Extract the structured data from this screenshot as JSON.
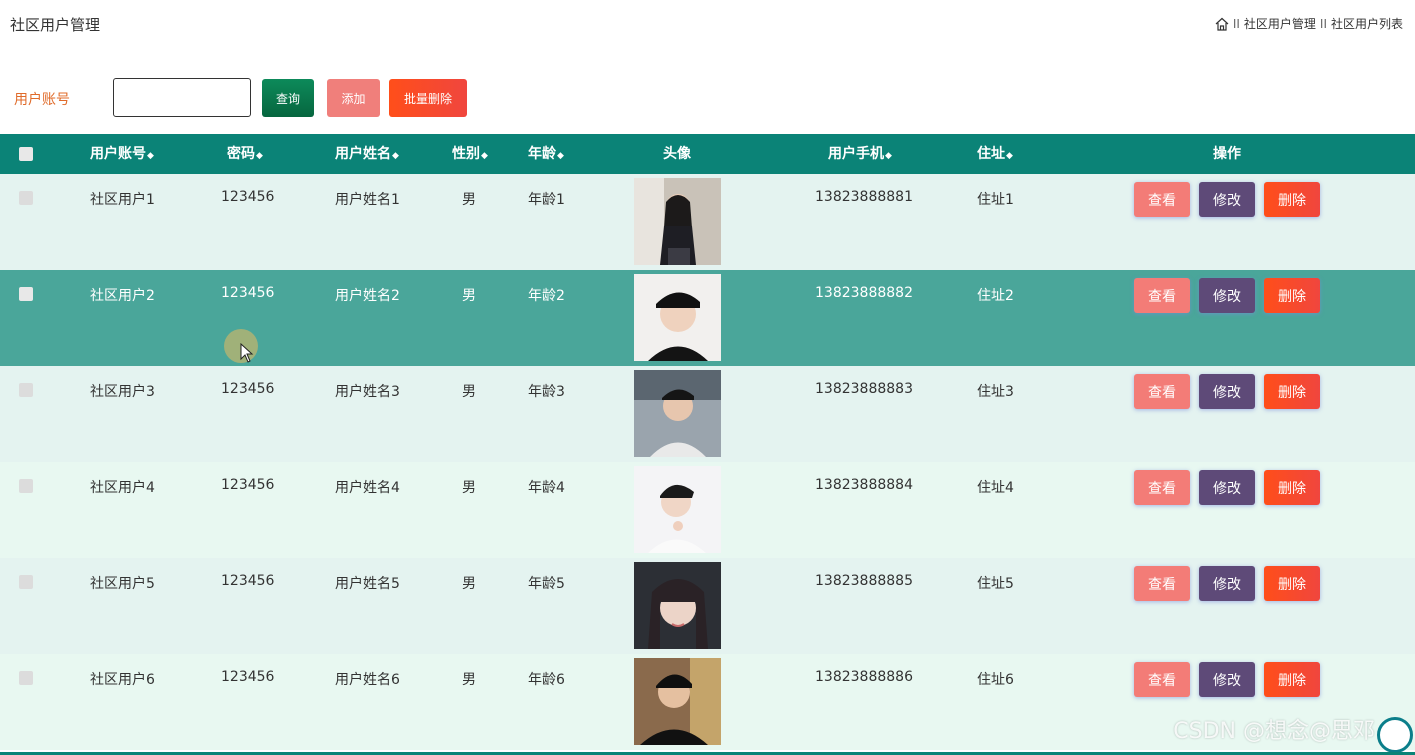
{
  "header": {
    "title": "社区用户管理",
    "breadcrumb": [
      "社区用户管理",
      "社区用户列表"
    ],
    "breadcrumb_sep": "II"
  },
  "search": {
    "label": "用户账号",
    "value": "",
    "query_label": "查询",
    "add_label": "添加",
    "batch_delete_label": "批量删除"
  },
  "table": {
    "columns": [
      "用户账号",
      "密码",
      "用户姓名",
      "性别",
      "年龄",
      "头像",
      "用户手机",
      "住址",
      "操作"
    ],
    "sort_glyph": "◆",
    "rows": [
      {
        "account": "社区用户1",
        "password": "123456",
        "name": "用户姓名1",
        "gender": "男",
        "age": "年龄1",
        "phone": "13823888881",
        "address": "住址1"
      },
      {
        "account": "社区用户2",
        "password": "123456",
        "name": "用户姓名2",
        "gender": "男",
        "age": "年龄2",
        "phone": "13823888882",
        "address": "住址2"
      },
      {
        "account": "社区用户3",
        "password": "123456",
        "name": "用户姓名3",
        "gender": "男",
        "age": "年龄3",
        "phone": "13823888883",
        "address": "住址3"
      },
      {
        "account": "社区用户4",
        "password": "123456",
        "name": "用户姓名4",
        "gender": "男",
        "age": "年龄4",
        "phone": "13823888884",
        "address": "住址4"
      },
      {
        "account": "社区用户5",
        "password": "123456",
        "name": "用户姓名5",
        "gender": "男",
        "age": "年龄5",
        "phone": "13823888885",
        "address": "住址5"
      },
      {
        "account": "社区用户6",
        "password": "123456",
        "name": "用户姓名6",
        "gender": "男",
        "age": "年龄6",
        "phone": "13823888886",
        "address": "住址6"
      }
    ],
    "actions": {
      "view": "查看",
      "edit": "修改",
      "delete": "删除"
    }
  },
  "watermark": "CSDN @想念@思邓",
  "colors": {
    "header_bg": "#0b8377",
    "highlight_row": "#4aa69a",
    "label": "#e06b2a"
  }
}
